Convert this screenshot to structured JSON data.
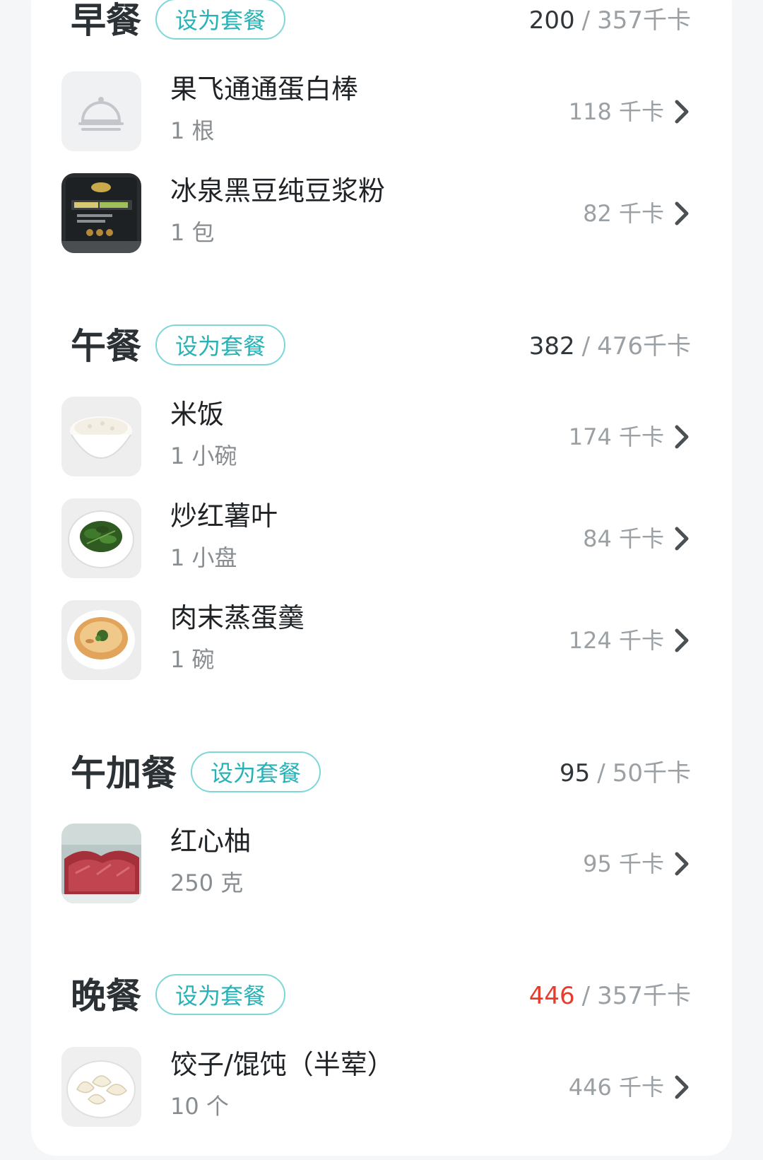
{
  "sections": [
    {
      "title": "早餐",
      "set_label": "设为套餐",
      "eaten": "200",
      "separator": "/",
      "target": "357千卡",
      "items": [
        {
          "name": "果飞通通蛋白棒",
          "qty": "1 根",
          "cal": "118 千卡",
          "icon": "food-placeholder-icon"
        },
        {
          "name": "冰泉黑豆纯豆浆粉",
          "qty": "1 包",
          "cal": "82 千卡",
          "icon": "soy-milk-package-image"
        }
      ]
    },
    {
      "title": "午餐",
      "set_label": "设为套餐",
      "eaten": "382",
      "separator": "/",
      "target": "476千卡",
      "items": [
        {
          "name": "米饭",
          "qty": "1 小碗",
          "cal": "174 千卡",
          "icon": "rice-bowl-image"
        },
        {
          "name": "炒红薯叶",
          "qty": "1 小盘",
          "cal": "84 千卡",
          "icon": "greens-plate-image"
        },
        {
          "name": "肉末蒸蛋羹",
          "qty": "1 碗",
          "cal": "124 千卡",
          "icon": "egg-custard-image"
        }
      ]
    },
    {
      "title": "午加餐",
      "set_label": "设为套餐",
      "eaten": "95",
      "separator": "/",
      "target": "50千卡",
      "items": [
        {
          "name": "红心柚",
          "qty": "250 克",
          "cal": "95 千卡",
          "icon": "grapefruit-image"
        }
      ]
    },
    {
      "title": "晚餐",
      "set_label": "设为套餐",
      "eaten": "446",
      "separator": "/",
      "target": "357千卡",
      "eaten_over_target": true,
      "items": [
        {
          "name": "饺子/馄饨（半荤）",
          "qty": "10 个",
          "cal": "446 千卡",
          "icon": "dumplings-image"
        }
      ]
    }
  ],
  "colors": {
    "accent_teal": "#26b2b6",
    "over_limit_red": "#ea3b2a",
    "title_text": "#2b3135",
    "muted_text": "#9aa0a4"
  }
}
